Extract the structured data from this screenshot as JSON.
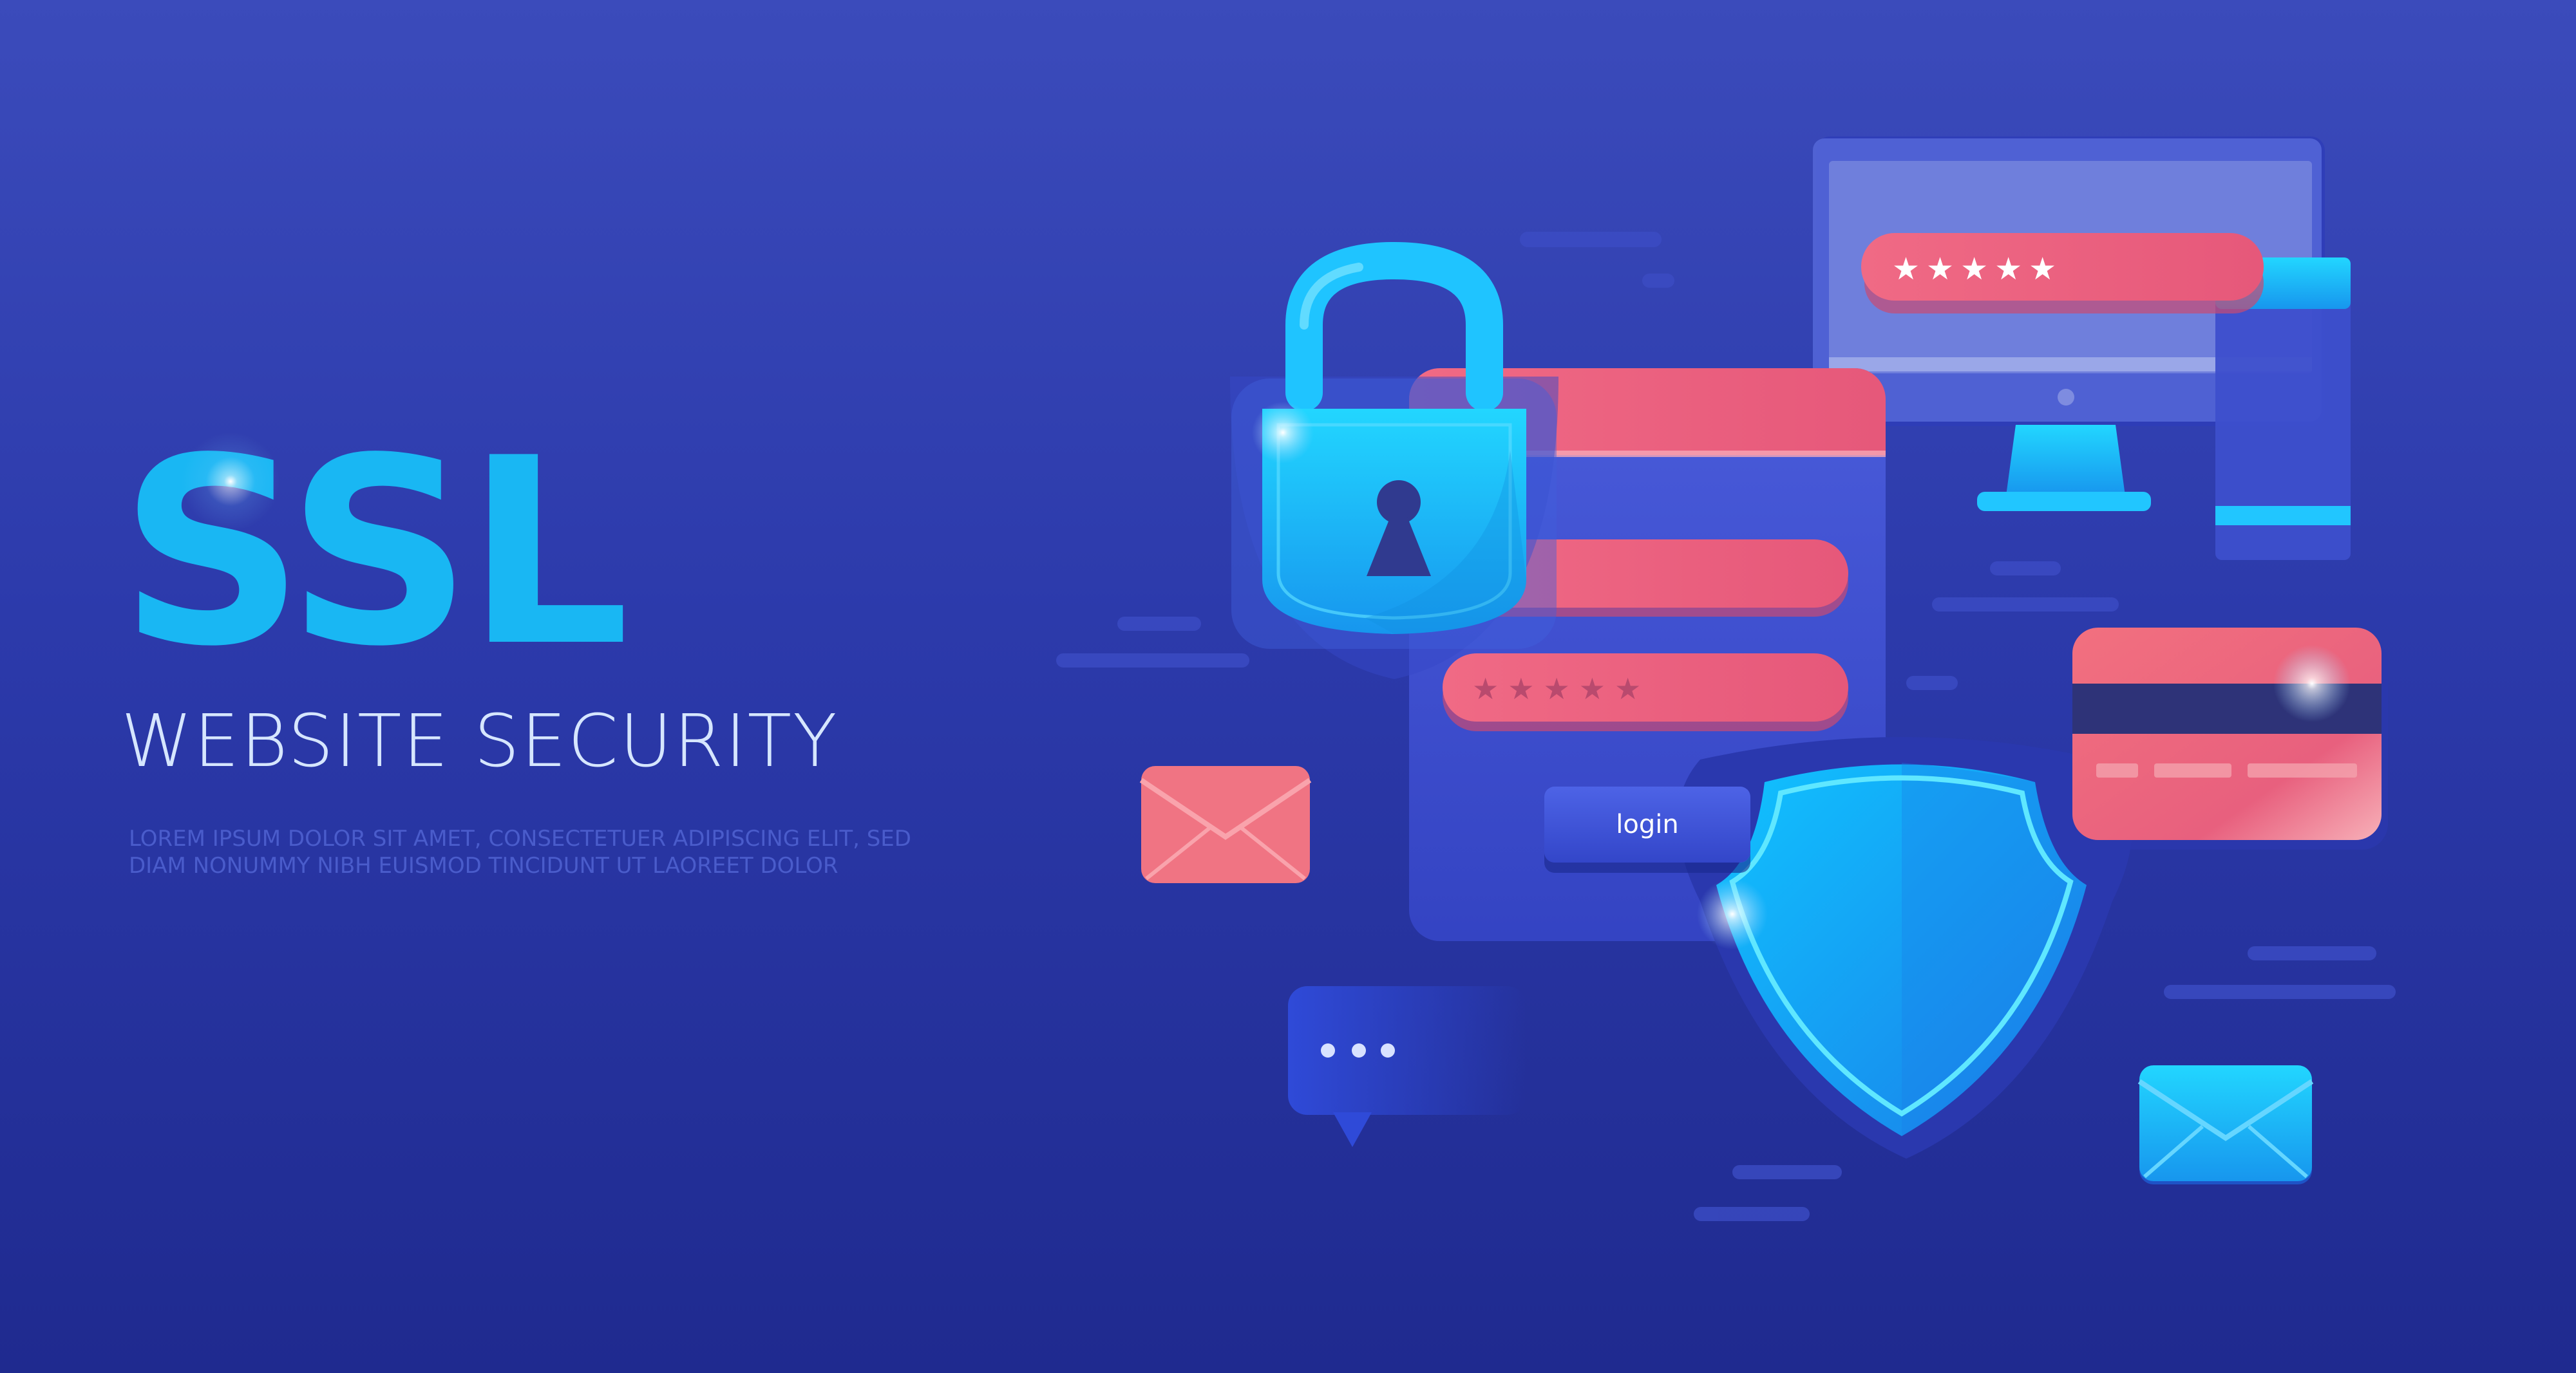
{
  "hero": {
    "title": "SSL",
    "subtitle": "WEBSITE SECURITY",
    "description": "LOREM IPSUM DOLOR SIT AMET, CONSECTETUER ADIPISCING ELIT, SED DIAM NONUMMY NIBH EUISMOD TINCIDUNT UT LAOREET DOLOR"
  },
  "login_form": {
    "button_label": "login",
    "password_mask": "★★★★★"
  },
  "monitor": {
    "password_mask": "★★★★★"
  },
  "icons": {
    "padlock": "padlock-icon",
    "shield": "shield-icon",
    "monitor": "monitor-icon",
    "credit_card": "credit-card-icon",
    "envelope_red": "envelope-icon",
    "envelope_blue": "envelope-icon",
    "chat_bubble": "chat-bubble-icon"
  },
  "colors": {
    "background_top": "#3b4bbb",
    "background_bottom": "#1f2a8f",
    "accent_cyan": "#19b7f3",
    "accent_pink": "#f0607e",
    "text_light": "#d6e6ff"
  }
}
